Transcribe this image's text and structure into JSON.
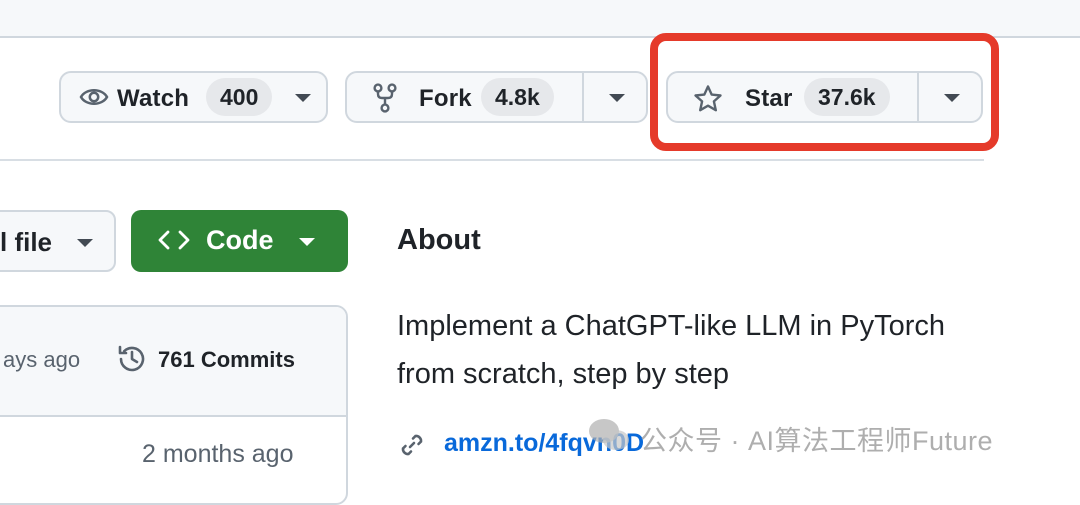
{
  "actions": {
    "watch": {
      "label": "Watch",
      "count": "400"
    },
    "fork": {
      "label": "Fork",
      "count": "4.8k"
    },
    "star": {
      "label": "Star",
      "count": "37.6k"
    }
  },
  "file_button_label": "l file",
  "code_button_label": "Code",
  "commits": {
    "left_time": "ays ago",
    "count_label": "761 Commits",
    "row_time": "2 months ago"
  },
  "about": {
    "title": "About",
    "description": "Implement a ChatGPT-like LLM in PyTorch from scratch, step by step",
    "link": "amzn.to/4fqvn0D"
  },
  "watermark": "公众号 · AI算法工程师Future",
  "colors": {
    "highlight": "#e53a2a",
    "code_button": "#2f8437",
    "link": "#0969da"
  },
  "icons": [
    "eye-icon",
    "fork-icon",
    "star-icon",
    "caret-down-icon",
    "code-icon",
    "history-icon",
    "link-icon",
    "wechat-icon"
  ]
}
